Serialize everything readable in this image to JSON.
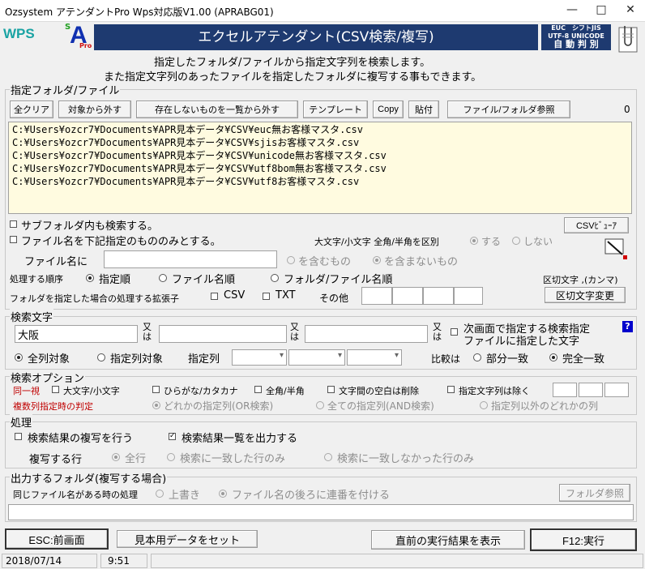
{
  "window": {
    "title": "Ozsystem アテンダントPro Wps対応版V1.00 (APRABG01)"
  },
  "logos": {
    "wps": "WPS",
    "sa_s": "S",
    "sa_a": "A",
    "sa_pro": "Pro"
  },
  "banner": {
    "title": "エクセルアテンダント(CSV検索/複写)",
    "badge_line1": "EUC　シフトJIS",
    "badge_line2": "UTF-8 UNICODE",
    "badge_line3": "自 動 判 別"
  },
  "intro": {
    "line1": "指定したフォルダ/ファイルから指定文字列を検索します。",
    "line2": "また指定文字列のあったファイルを指定したフォルダに複写する事もできます。"
  },
  "folder_section": {
    "label": "指定フォルダ/ファイル",
    "buttons": {
      "clear_all": "全クリア",
      "remove": "対象から外す",
      "remove_missing": "存在しないものを一覧から外す",
      "template": "テンプレート",
      "copy": "Copy",
      "paste": "貼付",
      "browse": "ファイル/フォルダ参照"
    },
    "count": "0",
    "files": [
      "C:¥Users¥ozcr7¥Documents¥APR見本データ¥CSV¥euc無お客様マスタ.csv",
      "C:¥Users¥ozcr7¥Documents¥APR見本データ¥CSV¥sjisお客様マスタ.csv",
      "C:¥Users¥ozcr7¥Documents¥APR見本データ¥CSV¥unicode無お客様マスタ.csv",
      "C:¥Users¥ozcr7¥Documents¥APR見本データ¥CSV¥utf8bom無お客様マスタ.csv",
      "C:¥Users¥ozcr7¥Documents¥APR見本データ¥CSV¥utf8お客様マスタ.csv"
    ],
    "subfolder_label": "サブフォルダ内も検索する。",
    "csv_viewer": "CSVﾋﾞｭｰｱ",
    "filename_only_label": "ファイル名を下記指定のもののみとする。",
    "case_label": "大文字/小文字 全角/半角を区別",
    "case_yes": "する",
    "case_no": "しない",
    "filename_label": "ファイル名に",
    "contains": "を含むもの",
    "not_contains": "を含まないもの",
    "order_label": "処理する順序",
    "order_specified": "指定順",
    "order_filename": "ファイル名順",
    "order_folder": "フォルダ/ファイル名順",
    "delim_label": "区切文字 ,(カンマ)",
    "ext_label": "フォルダを指定した場合の処理する拡張子",
    "ext_csv": "CSV",
    "ext_txt": "TXT",
    "ext_other": "その他",
    "delim_change": "区切文字変更"
  },
  "search": {
    "label": "検索文字",
    "value1": "大阪",
    "or1": "又は",
    "or2": "又は",
    "or3": "又は",
    "next_screen_line1": "次画面で指定する検索指定",
    "next_screen_line2": "ファイルに指定した文字",
    "help": "?",
    "all_columns": "全列対象",
    "specified_columns": "指定列対象",
    "column_label": "指定列",
    "compare_label": "比較は",
    "partial": "部分一致",
    "exact": "完全一致"
  },
  "options": {
    "label": "検索オプション",
    "same_label": "同一視",
    "case": "大文字/小文字",
    "kana": "ひらがな/カタカナ",
    "width": "全角/半角",
    "spaces": "文字間の空白は削除",
    "exclude": "指定文字列は除く",
    "multi_label": "複数列指定時の判定",
    "any": "どれかの指定列(OR検索)",
    "all": "全ての指定列(AND検索)",
    "other": "指定列以外のどれかの列"
  },
  "process": {
    "label": "処理",
    "copy_results": "検索結果の複写を行う",
    "output_list": "検索結果一覧を出力する",
    "copy_rows_label": "複写する行",
    "all_rows": "全行",
    "matched": "検索に一致した行のみ",
    "unmatched": "検索に一致しなかった行のみ"
  },
  "output": {
    "label": "出力するフォルダ(複写する場合)",
    "same_name_label": "同じファイル名がある時の処理",
    "overwrite": "上書き",
    "append_number": "ファイル名の後ろに連番を付ける",
    "browse": "フォルダ参照"
  },
  "bottom": {
    "back": "ESC:前画面",
    "sample": "見本用データをセット",
    "last_result": "直前の実行結果を表示",
    "run": "F12:実行"
  },
  "status": {
    "date": "2018/07/14",
    "time": "9:51"
  },
  "colors": {
    "banner_bg": "#1e3a70",
    "list_bg": "#fffbe0",
    "badge_bg": "#1e3a70",
    "help_bg": "#0000cc"
  }
}
